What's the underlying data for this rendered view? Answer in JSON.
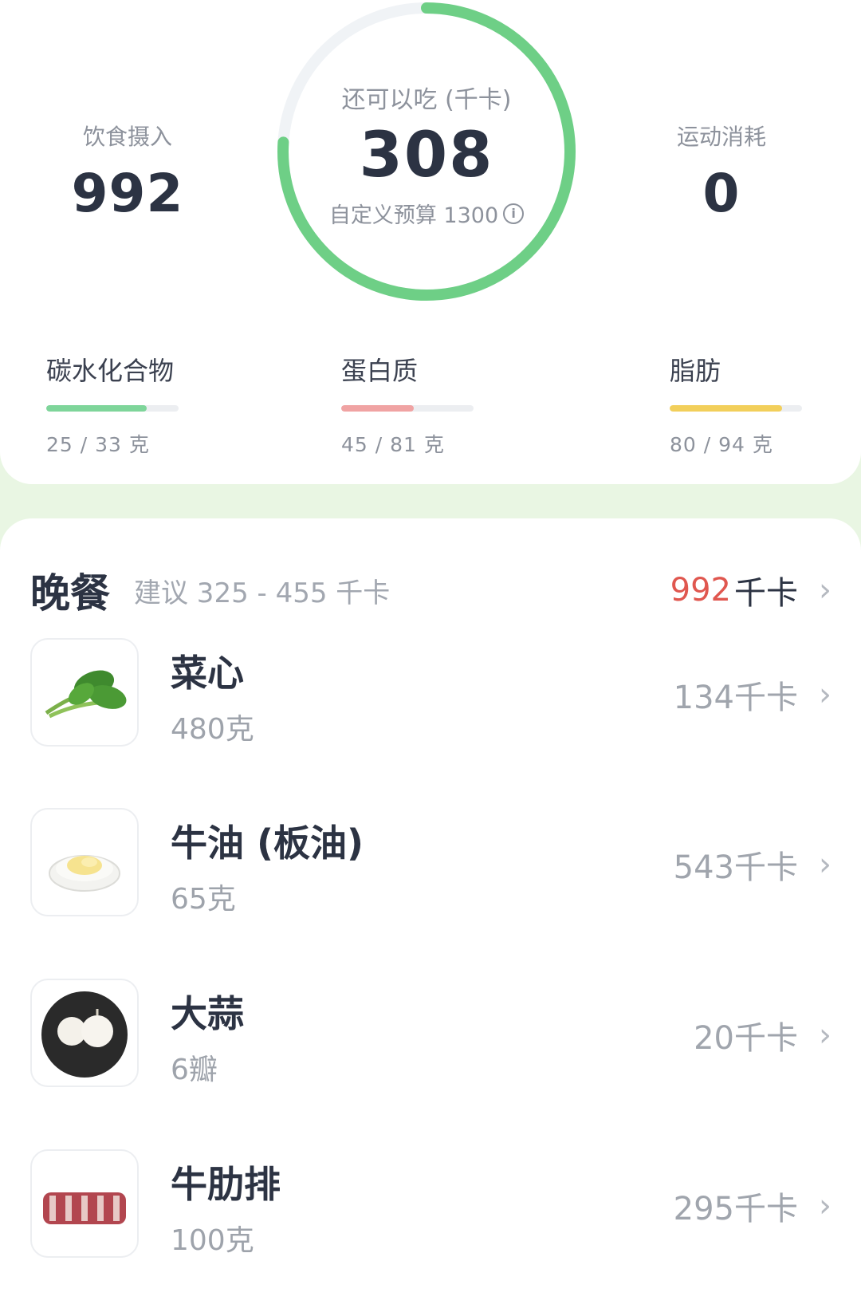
{
  "summary": {
    "intake_label": "饮食摄入",
    "intake_value": "992",
    "remaining_label": "还可以吃 (千卡)",
    "remaining_value": "308",
    "budget_text": "自定义预算 1300",
    "burn_label": "运动消耗",
    "burn_value": "0",
    "ring_progress": 0.76,
    "ring_color": "#6ecf86",
    "ring_track_color": "#f0f3f6"
  },
  "macros": [
    {
      "name": "碳水化合物",
      "amount": "25 / 33 克",
      "progress": 0.76,
      "color": "#7ed59a"
    },
    {
      "name": "蛋白质",
      "amount": "45 / 81 克",
      "progress": 0.55,
      "color": "#f0a3a3"
    },
    {
      "name": "脂肪",
      "amount": "80 / 94 克",
      "progress": 0.85,
      "color": "#f2cf5b"
    }
  ],
  "meal": {
    "title": "晚餐",
    "suggest": "建议 325 - 455 千卡",
    "total_value": "992",
    "total_unit": "千卡",
    "chevron": "›",
    "items": [
      {
        "name": "菜心",
        "qty": "480克",
        "kcal": "134千卡",
        "icon": "choy-sum-image"
      },
      {
        "name": "牛油 (板油)",
        "qty": "65克",
        "kcal": "543千卡",
        "icon": "butter-image"
      },
      {
        "name": "大蒜",
        "qty": "6瓣",
        "kcal": "20千卡",
        "icon": "garlic-image"
      },
      {
        "name": "牛肋排",
        "qty": "100克",
        "kcal": "295千卡",
        "icon": "beef-rib-image"
      }
    ]
  },
  "info_glyph": "i"
}
